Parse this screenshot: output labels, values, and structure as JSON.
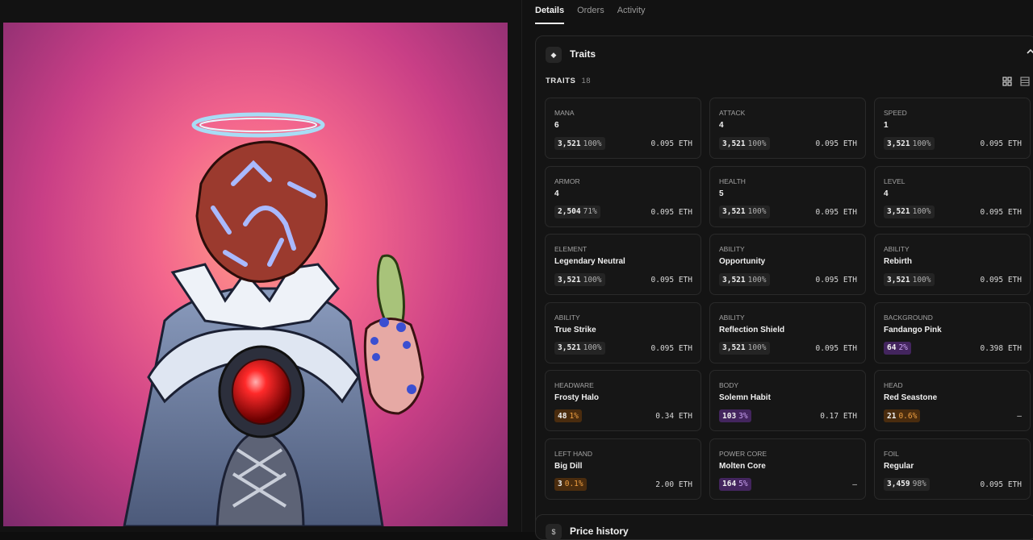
{
  "tabs": [
    {
      "label": "Details",
      "active": true
    },
    {
      "label": "Orders",
      "active": false
    },
    {
      "label": "Activity",
      "active": false
    }
  ],
  "traits_panel": {
    "title": "Traits",
    "header_icon": "diamond-icon",
    "collapse_icon": "chevron-up-icon",
    "traits_label": "TRAITS",
    "traits_count": "18",
    "view_icons": [
      "grid-view-icon",
      "list-view-icon"
    ]
  },
  "traits": [
    {
      "name": "MANA",
      "value": "6",
      "count": "3,521",
      "percent": "100%",
      "price": "0.095 ETH",
      "rarity": "default"
    },
    {
      "name": "ATTACK",
      "value": "4",
      "count": "3,521",
      "percent": "100%",
      "price": "0.095 ETH",
      "rarity": "default"
    },
    {
      "name": "SPEED",
      "value": "1",
      "count": "3,521",
      "percent": "100%",
      "price": "0.095 ETH",
      "rarity": "default"
    },
    {
      "name": "ARMOR",
      "value": "4",
      "count": "2,504",
      "percent": "71%",
      "price": "0.095 ETH",
      "rarity": "default"
    },
    {
      "name": "HEALTH",
      "value": "5",
      "count": "3,521",
      "percent": "100%",
      "price": "0.095 ETH",
      "rarity": "default"
    },
    {
      "name": "LEVEL",
      "value": "4",
      "count": "3,521",
      "percent": "100%",
      "price": "0.095 ETH",
      "rarity": "default"
    },
    {
      "name": "ELEMENT",
      "value": "Legendary Neutral",
      "count": "3,521",
      "percent": "100%",
      "price": "0.095 ETH",
      "rarity": "default"
    },
    {
      "name": "ABILITY",
      "value": "Opportunity",
      "count": "3,521",
      "percent": "100%",
      "price": "0.095 ETH",
      "rarity": "default"
    },
    {
      "name": "ABILITY",
      "value": "Rebirth",
      "count": "3,521",
      "percent": "100%",
      "price": "0.095 ETH",
      "rarity": "default"
    },
    {
      "name": "ABILITY",
      "value": "True Strike",
      "count": "3,521",
      "percent": "100%",
      "price": "0.095 ETH",
      "rarity": "default"
    },
    {
      "name": "ABILITY",
      "value": "Reflection Shield",
      "count": "3,521",
      "percent": "100%",
      "price": "0.095 ETH",
      "rarity": "default"
    },
    {
      "name": "BACKGROUND",
      "value": "Fandango Pink",
      "count": "64",
      "percent": "2%",
      "price": "0.398 ETH",
      "rarity": "purple"
    },
    {
      "name": "HEADWARE",
      "value": "Frosty Halo",
      "count": "48",
      "percent": "1%",
      "price": "0.34 ETH",
      "rarity": "orange"
    },
    {
      "name": "BODY",
      "value": "Solemn Habit",
      "count": "103",
      "percent": "3%",
      "price": "0.17 ETH",
      "rarity": "purple"
    },
    {
      "name": "HEAD",
      "value": "Red Seastone",
      "count": "21",
      "percent": "0.6%",
      "price": "–",
      "rarity": "orange"
    },
    {
      "name": "LEFT HAND",
      "value": "Big Dill",
      "count": "3",
      "percent": "0.1%",
      "price": "2.00 ETH",
      "rarity": "orange"
    },
    {
      "name": "POWER CORE",
      "value": "Molten Core",
      "count": "164",
      "percent": "5%",
      "price": "–",
      "rarity": "purple"
    },
    {
      "name": "FOIL",
      "value": "Regular",
      "count": "3,459",
      "percent": "98%",
      "price": "0.095 ETH",
      "rarity": "default"
    }
  ],
  "price_history": {
    "title": "Price history",
    "icon": "dollar-icon"
  },
  "colors": {
    "rarity_purple": "#43255e",
    "rarity_orange": "#4a2c0e",
    "background": "#121212"
  }
}
